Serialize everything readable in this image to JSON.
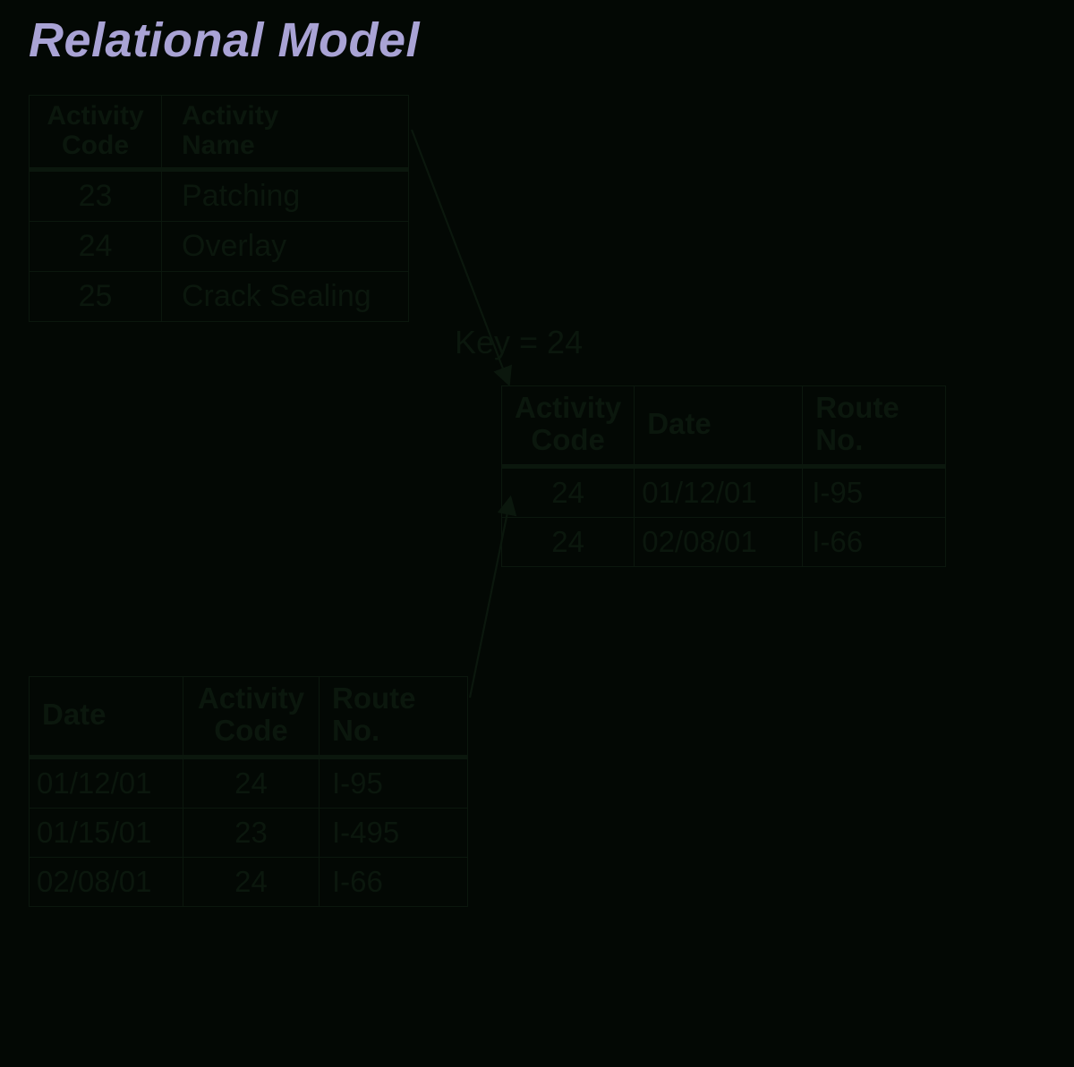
{
  "title": "Relational Model",
  "key_label": "Key = 24",
  "tables": {
    "activity": {
      "headers": {
        "c0": "Activity\nCode",
        "c1": "Activity\nName"
      },
      "rows": [
        {
          "code": "23",
          "name": "Patching"
        },
        {
          "code": "24",
          "name": "Overlay"
        },
        {
          "code": "25",
          "name": "Crack Sealing"
        }
      ]
    },
    "log": {
      "headers": {
        "c0": "Date",
        "c1": "Activity\nCode",
        "c2": "Route No."
      },
      "rows": [
        {
          "date": "01/12/01",
          "code": "24",
          "route": "I-95"
        },
        {
          "date": "01/15/01",
          "code": "23",
          "route": "I-495"
        },
        {
          "date": "02/08/01",
          "code": "24",
          "route": "I-66"
        }
      ]
    },
    "result": {
      "headers": {
        "c0": "Activity\nCode",
        "c1": "Date",
        "c2": "Route No."
      },
      "rows": [
        {
          "code": "24",
          "date": "01/12/01",
          "route": "I-95"
        },
        {
          "code": "24",
          "date": "02/08/01",
          "route": "I-66"
        }
      ]
    }
  }
}
